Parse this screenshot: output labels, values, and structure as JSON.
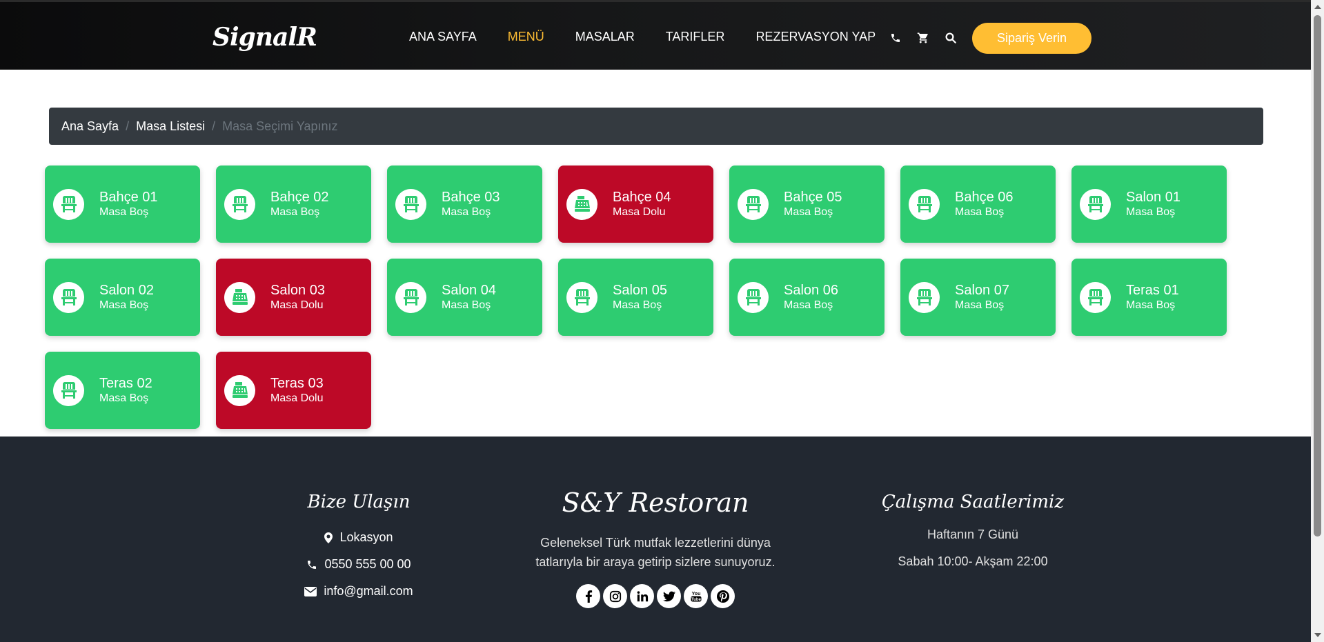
{
  "header": {
    "logo": "SignalR",
    "nav": [
      {
        "label": "ANA SAYFA",
        "active": false
      },
      {
        "label": "MENÜ",
        "active": true
      },
      {
        "label": "MASALAR",
        "active": false
      },
      {
        "label": "TARIFLER",
        "active": false
      },
      {
        "label": "REZERVASYON YAP",
        "active": false
      }
    ],
    "icons": [
      "phone-icon",
      "cart-icon",
      "search-icon"
    ],
    "order_button": "Sipariş Verin"
  },
  "breadcrumb": {
    "home": "Ana Sayfa",
    "list": "Masa Listesi",
    "current": "Masa Seçimi Yapınız",
    "separator": "/"
  },
  "tables": [
    {
      "name": "Bahçe 01",
      "status": "Masa Boş",
      "state": "empty"
    },
    {
      "name": "Bahçe 02",
      "status": "Masa Boş",
      "state": "empty"
    },
    {
      "name": "Bahçe 03",
      "status": "Masa Boş",
      "state": "empty"
    },
    {
      "name": "Bahçe 04",
      "status": "Masa Dolu",
      "state": "full"
    },
    {
      "name": "Bahçe 05",
      "status": "Masa Boş",
      "state": "empty"
    },
    {
      "name": "Bahçe 06",
      "status": "Masa Boş",
      "state": "empty"
    },
    {
      "name": "Salon 01",
      "status": "Masa Boş",
      "state": "empty"
    },
    {
      "name": "Salon 02",
      "status": "Masa Boş",
      "state": "empty"
    },
    {
      "name": "Salon 03",
      "status": "Masa Dolu",
      "state": "full"
    },
    {
      "name": "Salon 04",
      "status": "Masa Boş",
      "state": "empty"
    },
    {
      "name": "Salon 05",
      "status": "Masa Boş",
      "state": "empty"
    },
    {
      "name": "Salon 06",
      "status": "Masa Boş",
      "state": "empty"
    },
    {
      "name": "Salon 07",
      "status": "Masa Boş",
      "state": "empty"
    },
    {
      "name": "Teras 01",
      "status": "Masa Boş",
      "state": "empty"
    },
    {
      "name": "Teras 02",
      "status": "Masa Boş",
      "state": "empty"
    },
    {
      "name": "Teras 03",
      "status": "Masa Dolu",
      "state": "full"
    }
  ],
  "footer": {
    "contact_heading": "Bize Ulaşın",
    "location": "Lokasyon",
    "phone": "0550 555 00 00",
    "email": "info@gmail.com",
    "brand": "S&Y Restoran",
    "description_line1": "Geleneksel Türk mutfak lezzetlerini dünya",
    "description_line2": "tatlarıyla bir araya getirip sizlere sunuyoruz.",
    "socials": [
      "facebook-icon",
      "instagram-icon",
      "linkedin-icon",
      "twitter-icon",
      "youtube-icon",
      "pinterest-icon"
    ],
    "hours_heading": "Çalışma Saatlerimiz",
    "hours_days": "Haftanın 7 Günü",
    "hours_time": "Sabah 10:00- Akşam 22:00"
  },
  "colors": {
    "accent": "#ffbe33",
    "empty": "#2ecc71",
    "full": "#bd0927",
    "footer_bg": "#222831",
    "breadcrumb_bg": "#343a40"
  }
}
